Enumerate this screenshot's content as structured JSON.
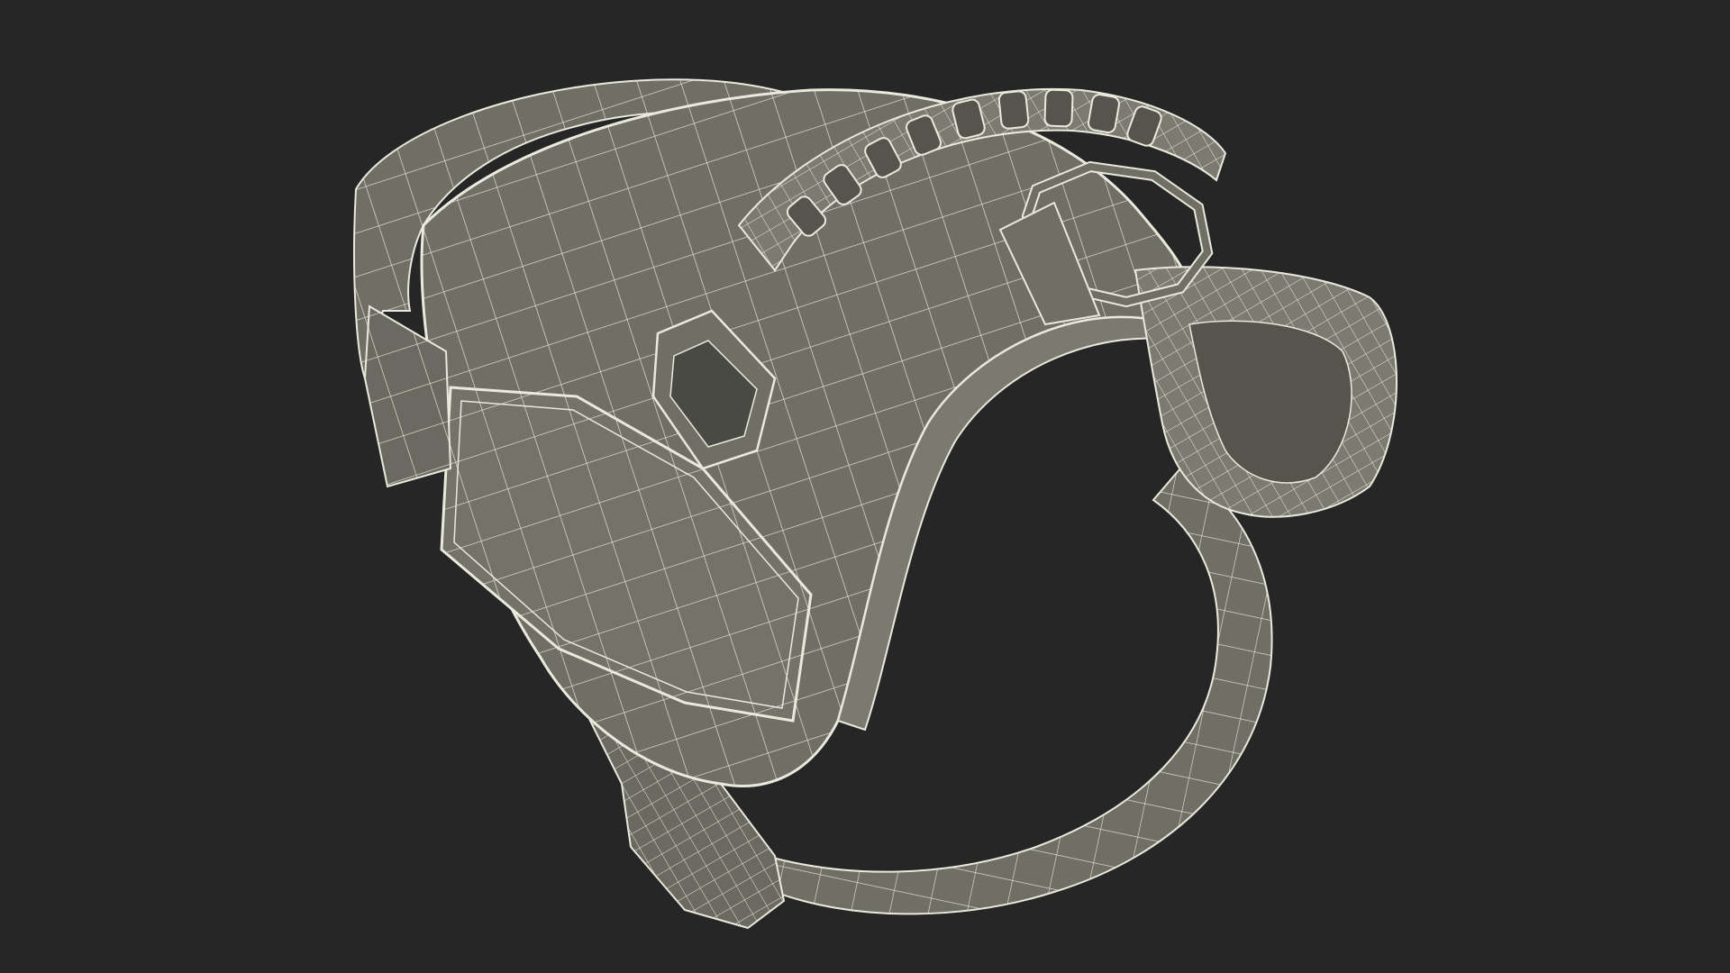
{
  "scene": {
    "background_color": "#262626",
    "subject": "harness-wireframe-render",
    "render_style": "wireframe",
    "colors": {
      "surface": "#6f6f66",
      "surface_light": "#8a8a80",
      "surface_dark": "#55554d",
      "wire": "#e9e9dc"
    }
  }
}
